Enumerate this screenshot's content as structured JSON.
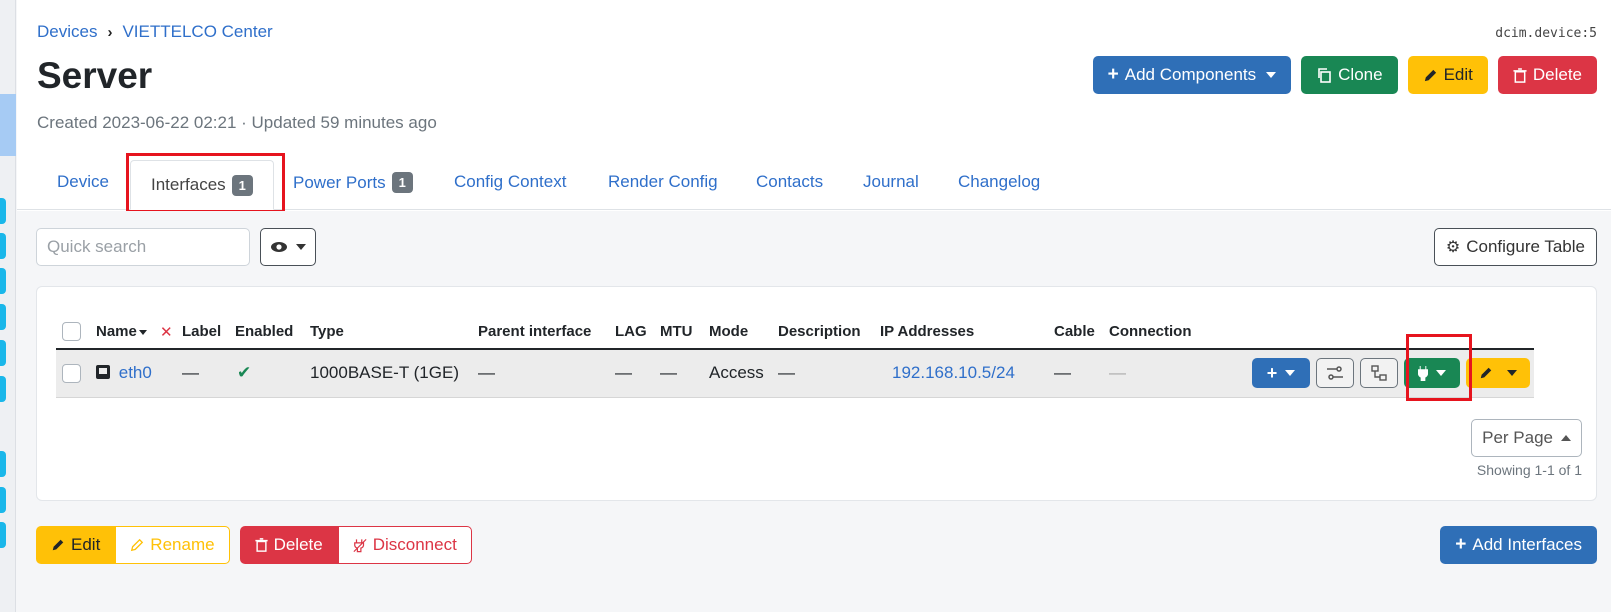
{
  "breadcrumb": [
    "Devices",
    "VIETTELCO Center"
  ],
  "object_id": "dcim.device:5",
  "title": "Server",
  "meta": "Created 2023-06-22 02:21 · Updated 59 minutes ago",
  "actions": {
    "add_components": "Add Components",
    "clone": "Clone",
    "edit": "Edit",
    "delete": "Delete"
  },
  "tabs": [
    {
      "label": "Device"
    },
    {
      "label": "Interfaces",
      "badge": "1"
    },
    {
      "label": "Power Ports",
      "badge": "1"
    },
    {
      "label": "Config Context"
    },
    {
      "label": "Render Config"
    },
    {
      "label": "Contacts"
    },
    {
      "label": "Journal"
    },
    {
      "label": "Changelog"
    }
  ],
  "search": {
    "placeholder": "Quick search"
  },
  "configure_table": "Configure Table",
  "table": {
    "columns": [
      "Name",
      "Label",
      "Enabled",
      "Type",
      "Parent interface",
      "LAG",
      "MTU",
      "Mode",
      "Description",
      "IP Addresses",
      "Cable",
      "Connection"
    ],
    "rows": [
      {
        "name": "eth0",
        "label": "—",
        "enabled": "✔",
        "type": "1000BASE-T (1GE)",
        "parent": "—",
        "lag": "—",
        "mtu": "—",
        "mode": "Access",
        "description": "—",
        "ip": "192.168.10.5/24",
        "cable": "—",
        "connection": "—"
      }
    ]
  },
  "per_page": "Per Page",
  "showing": "Showing 1-1 of 1",
  "bulk": {
    "edit": "Edit",
    "rename": "Rename",
    "delete": "Delete",
    "disconnect": "Disconnect"
  },
  "add_interfaces": "Add Interfaces",
  "colors": {
    "primary": "#2f6fb7",
    "success": "#198754",
    "warning": "#ffc107",
    "danger": "#dc3545",
    "highlight": "#e6141e"
  }
}
